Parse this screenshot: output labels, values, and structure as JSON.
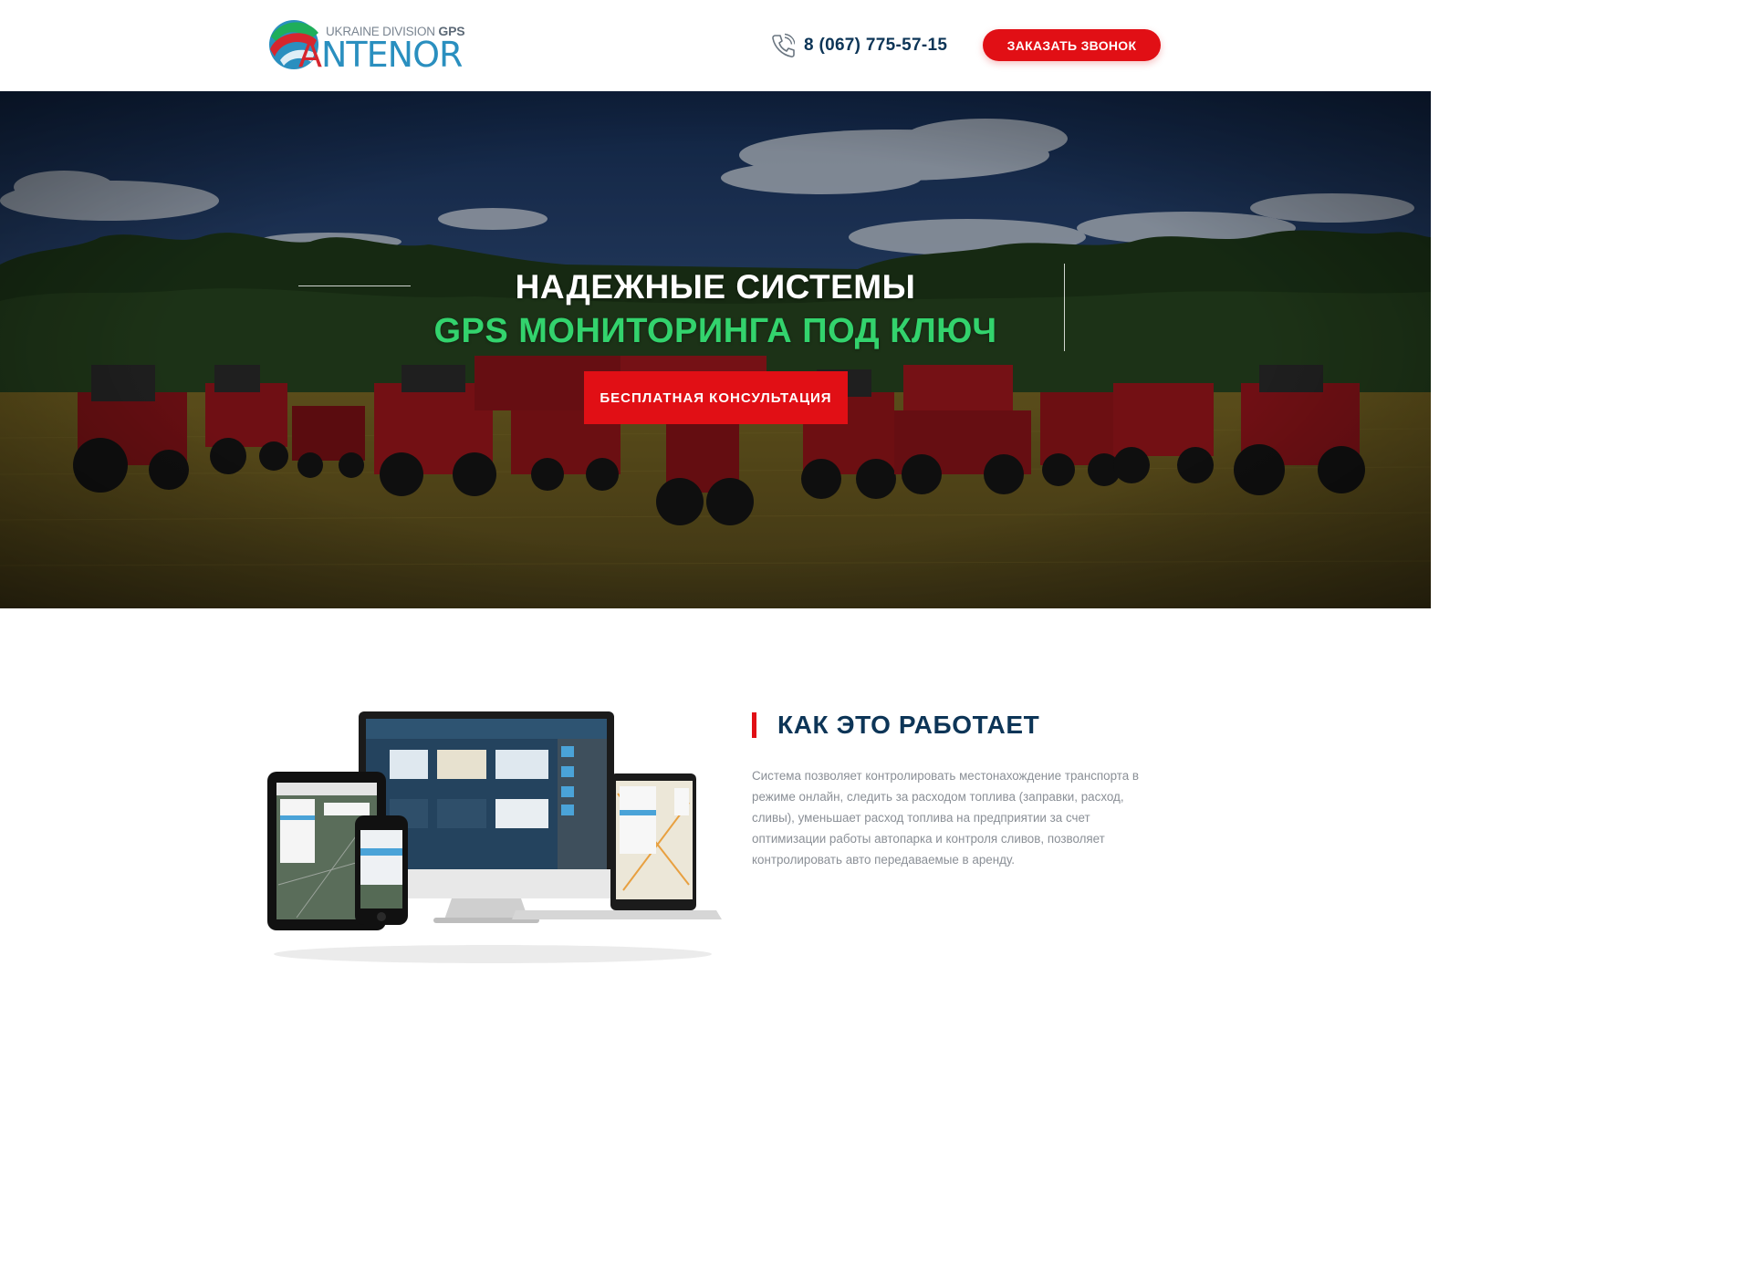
{
  "header": {
    "logo": {
      "subtitle_prefix": "UKRAINE DIVISION",
      "subtitle_bold": "GPS",
      "name": "ANTENOR"
    },
    "phone": "8 (067) 775-57-15",
    "call_button_label": "ЗАКАЗАТЬ ЗВОНОК"
  },
  "hero": {
    "title_line1": "НАДЕЖНЫЕ СИСТЕМЫ",
    "title_line2": "GPS МОНИТОРИНГА ПОД КЛЮЧ",
    "cta_label": "БЕСПЛАТНАЯ КОНСУЛЬТАЦИЯ"
  },
  "how_it_works": {
    "title": "КАК ЭТО РАБОТАЕТ",
    "text": "Система позволяет контролировать местонахождение транспорта в режиме онлайн, следить за расходом топлива (заправки, расход, сливы), уменьшает расход топлива на предприятии за счет оптимизации работы автопарка и контроля сливов, позволяет контролировать авто передаваемые в аренду."
  },
  "colors": {
    "accent_red": "#e10f15",
    "navy": "#0d3557",
    "hero_green": "#33d36d",
    "body_text": "#8a8f96"
  },
  "icons": [
    "phone-icon",
    "logo-mark-icon"
  ]
}
